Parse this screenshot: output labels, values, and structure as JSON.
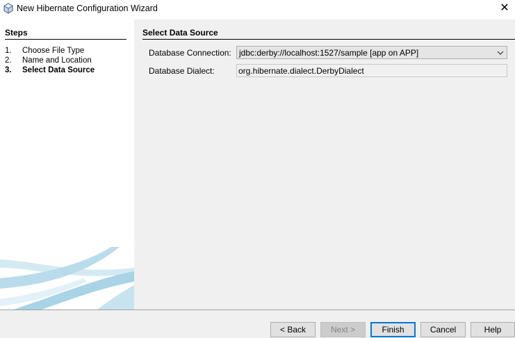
{
  "window": {
    "title": "New Hibernate Configuration Wizard",
    "close_glyph": "✕"
  },
  "steps": {
    "header": "Steps",
    "items": [
      {
        "num": "1.",
        "label": "Choose File Type"
      },
      {
        "num": "2.",
        "label": "Name and Location"
      },
      {
        "num": "3.",
        "label": "Select Data Source"
      }
    ]
  },
  "content": {
    "header": "Select Data Source",
    "connection_label": "Database Connection:",
    "connection_value": "jdbc:derby://localhost:1527/sample [app on APP]",
    "dialect_label": "Database Dialect:",
    "dialect_value": "org.hibernate.dialect.DerbyDialect"
  },
  "buttons": {
    "back": "< Back",
    "next": "Next >",
    "finish": "Finish",
    "cancel": "Cancel",
    "help": "Help"
  },
  "colors": {
    "content_bg": "#f0f0f0",
    "default_button_border": "#0078d7",
    "swoosh": "#a9d4e6"
  },
  "icons": {
    "app": "hibernate-cube-icon",
    "combo_arrow": "chevron-down-icon"
  }
}
